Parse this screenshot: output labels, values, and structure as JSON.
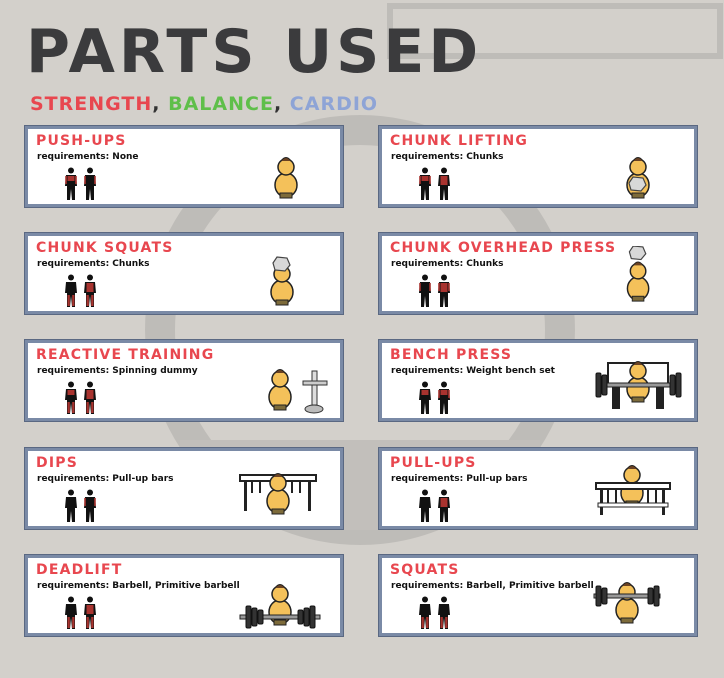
{
  "title": "PARTS USED",
  "legend": {
    "strength": {
      "label": "STRENGTH",
      "color": "#e8474f"
    },
    "balance": {
      "label": "BALANCE",
      "color": "#5fbf4a"
    },
    "cardio": {
      "label": "CARDIO",
      "color": "#8ea4d6"
    },
    "separator": ","
  },
  "cards": [
    {
      "title": "PUSH-UPS",
      "requirements": "requirements: None",
      "equipment_icon": "pawn-icon"
    },
    {
      "title": "CHUNK LIFTING",
      "requirements": "requirements: Chunks",
      "equipment_icon": "pawn-holding-chunk-icon"
    },
    {
      "title": "CHUNK SQUATS",
      "requirements": "requirements: Chunks",
      "equipment_icon": "pawn-chunk-on-head-icon"
    },
    {
      "title": "CHUNK OVERHEAD PRESS",
      "requirements": "requirements: Chunks",
      "equipment_icon": "pawn-chunk-overhead-icon"
    },
    {
      "title": "REACTIVE TRAINING",
      "requirements": "requirements: Spinning dummy",
      "equipment_icon": "spinning-dummy-icon"
    },
    {
      "title": "BENCH PRESS",
      "requirements": "requirements: Weight bench set",
      "equipment_icon": "weight-bench-icon"
    },
    {
      "title": "DIPS",
      "requirements": "requirements: Pull-up bars",
      "equipment_icon": "dip-bars-icon"
    },
    {
      "title": "PULL-UPS",
      "requirements": "requirements: Pull-up bars",
      "equipment_icon": "pull-up-bars-icon"
    },
    {
      "title": "DEADLIFT",
      "requirements": "requirements: Barbell, Primitive barbell",
      "equipment_icon": "barbell-icon"
    },
    {
      "title": "SQUATS",
      "requirements": "requirements: Barbell, Primitive barbell",
      "equipment_icon": "barbell-squat-icon"
    }
  ]
}
